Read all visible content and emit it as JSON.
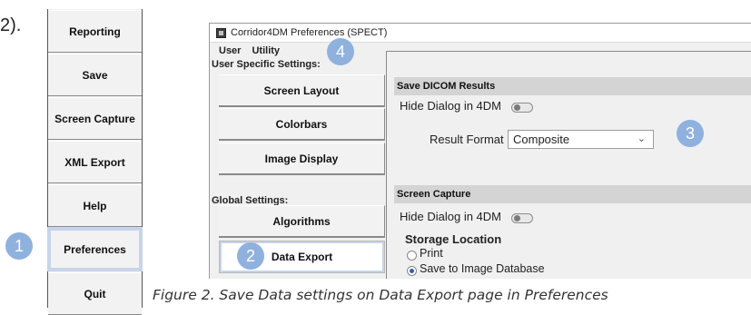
{
  "step_label": "2).",
  "toolbar": {
    "buttons": [
      {
        "label": "Reporting"
      },
      {
        "label": "Save"
      },
      {
        "label": "Screen Capture"
      },
      {
        "label": "XML Export"
      },
      {
        "label": "Help"
      },
      {
        "label": "Preferences",
        "selected": true
      },
      {
        "label": "Quit"
      }
    ]
  },
  "callouts": {
    "c1": "1",
    "c2": "2",
    "c3": "3",
    "c4": "4"
  },
  "window": {
    "title": "Corridor4DM Preferences (SPECT)",
    "menu": [
      "User",
      "Utility"
    ],
    "user_settings_heading": "User Specific Settings:",
    "user_nav": [
      "Screen Layout",
      "Colorbars",
      "Image Display"
    ],
    "global_settings_heading": "Global Settings:",
    "global_nav": [
      "Algorithms",
      "Data Export"
    ],
    "active_nav": "Data Export",
    "save_dicom": {
      "header": "Save DICOM Results",
      "hide_dialog_label": "Hide Dialog in 4DM",
      "hide_dialog_on": false,
      "result_format_label": "Result Format",
      "result_format_value": "Composite"
    },
    "screen_capture": {
      "header": "Screen Capture",
      "hide_dialog_label": "Hide Dialog in 4DM",
      "hide_dialog_on": false,
      "storage_location_label": "Storage Location",
      "options": [
        "Print",
        "Save to Image Database"
      ],
      "selected_option": "Save to Image Database"
    }
  },
  "caption": "Figure 2.    Save Data settings on Data Export page in Preferences",
  "colors": {
    "callout": "#8fb1de",
    "selection_outline": "#c7d4ea",
    "group_header": "#d4d4d4"
  }
}
